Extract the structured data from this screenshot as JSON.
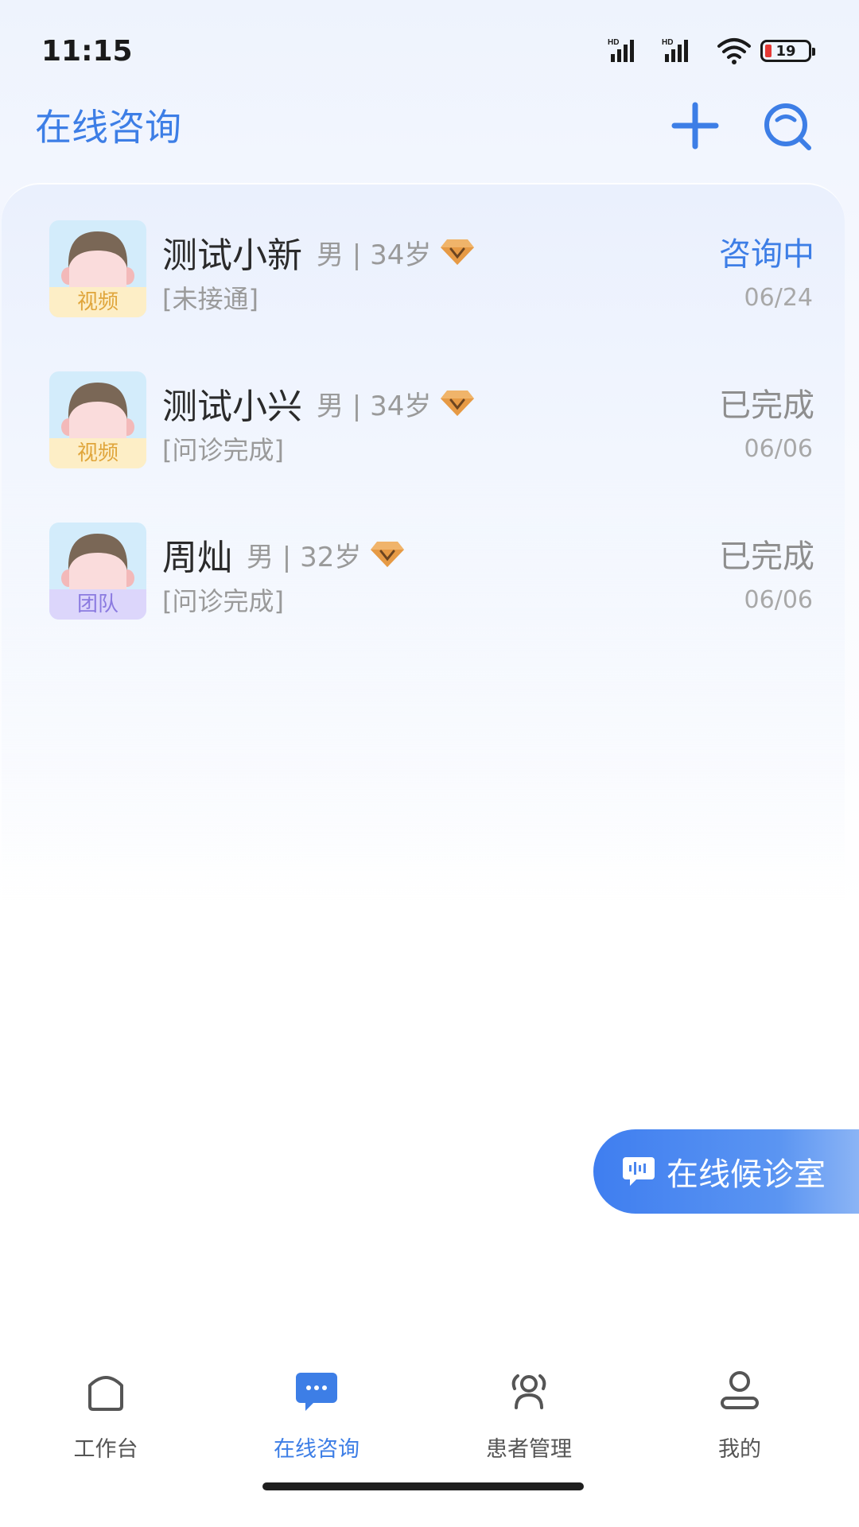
{
  "status_bar": {
    "time": "11:15",
    "battery": "19",
    "battery_color": "#e53935"
  },
  "header": {
    "title": "在线咨询",
    "add_icon": "plus-icon",
    "search_icon": "search-icon"
  },
  "consultations": [
    {
      "name": "测试小新",
      "meta": "男 | 34岁",
      "tag": "视频",
      "tag_type": "video",
      "sub": "[未接通]",
      "status": "咨询中",
      "active": true,
      "date": "06/24"
    },
    {
      "name": "测试小兴",
      "meta": "男 | 34岁",
      "tag": "视频",
      "tag_type": "video",
      "sub": "[问诊完成]",
      "status": "已完成",
      "active": false,
      "date": "06/06"
    },
    {
      "name": "周灿",
      "meta": "男 | 32岁",
      "tag": "团队",
      "tag_type": "team",
      "sub": "[问诊完成]",
      "status": "已完成",
      "active": false,
      "date": "06/06"
    }
  ],
  "waiting_room": {
    "label": "在线候诊室",
    "icon": "chat-bubble-icon"
  },
  "nav": [
    {
      "label": "工作台",
      "icon": "home-icon",
      "active": false
    },
    {
      "label": "在线咨询",
      "icon": "message-icon",
      "active": true
    },
    {
      "label": "患者管理",
      "icon": "patients-icon",
      "active": false
    },
    {
      "label": "我的",
      "icon": "profile-icon",
      "active": false
    }
  ],
  "colors": {
    "accent": "#3d7ee6",
    "tag_video_bg": "#fdeec6",
    "tag_team_bg": "#dcd6fb"
  }
}
